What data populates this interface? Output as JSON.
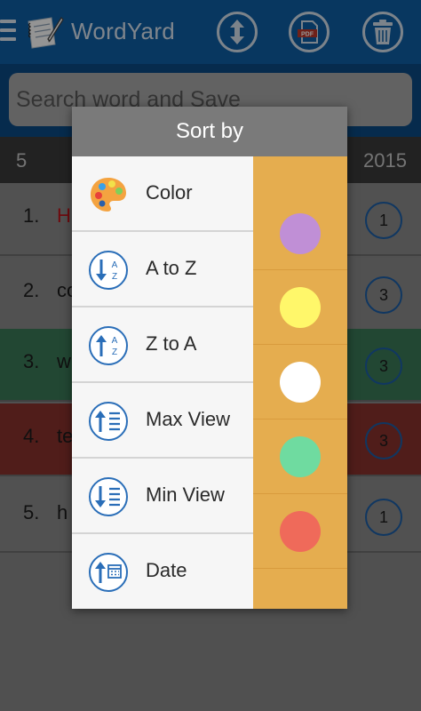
{
  "appbar": {
    "title": "WordYard",
    "menu_icon": "hamburger-menu-icon",
    "logo_icon": "notebook-pen-logo",
    "sort_icon": "up-down-arrows-icon",
    "pdf_icon": "pdf-document-icon",
    "pdf_label": "PDF",
    "trash_icon": "trash-can-icon",
    "color": "#0e5fa6"
  },
  "search": {
    "placeholder": "Search word and Save"
  },
  "list_header": {
    "count": "5",
    "year": "2015"
  },
  "rows": [
    {
      "num": "1.",
      "word": "H",
      "word_color": "#c0141b",
      "bg": "#8c8c8c",
      "badge": "1"
    },
    {
      "num": "2.",
      "word": "co",
      "word_color": "#1c1c1c",
      "bg": "#8c8c8c",
      "badge": "3"
    },
    {
      "num": "3.",
      "word": "w",
      "word_color": "#1c1c1c",
      "bg": "#3b7a59",
      "badge": "3"
    },
    {
      "num": "4.",
      "word": "te",
      "word_color": "#1c1c1c",
      "bg": "#8a322d",
      "badge": "3"
    },
    {
      "num": "5.",
      "word": "h",
      "word_color": "#1c1c1c",
      "bg": "#8c8c8c",
      "badge": "1"
    }
  ],
  "dialog": {
    "title": "Sort by",
    "options": [
      {
        "label": "Color",
        "icon": "palette-icon"
      },
      {
        "label": "A to Z",
        "icon": "sort-a-to-z-icon"
      },
      {
        "label": "Z to A",
        "icon": "sort-z-to-a-icon"
      },
      {
        "label": "Max View",
        "icon": "sort-max-view-icon"
      },
      {
        "label": "Min View",
        "icon": "sort-min-view-icon"
      },
      {
        "label": "Date",
        "icon": "sort-date-icon"
      }
    ],
    "panel_color": "#e5ad4f",
    "swatches": [
      "#c08fd6",
      "#fff76a",
      "#ffffff",
      "#6fdba0",
      "#ef6a5a"
    ]
  }
}
